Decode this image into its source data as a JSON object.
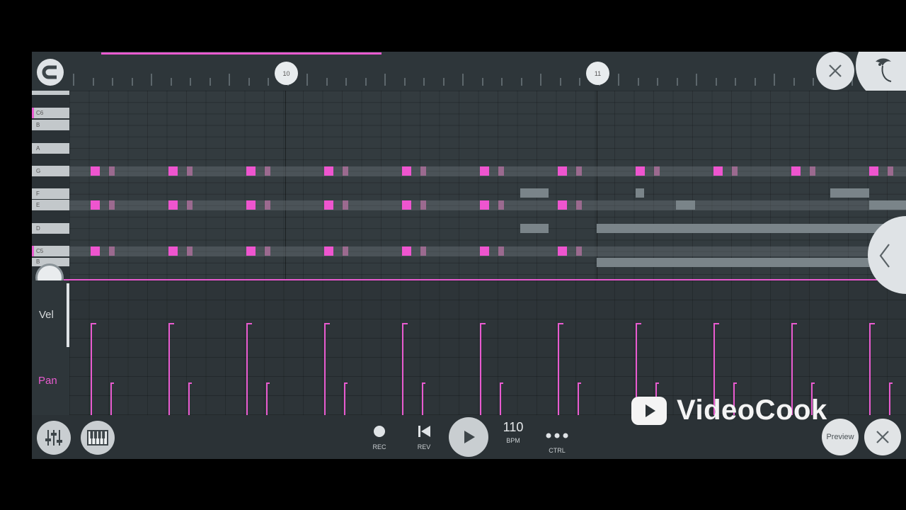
{
  "timeline": {
    "markers": [
      "10",
      "11"
    ]
  },
  "keyboard": {
    "keys": [
      {
        "label": "C6",
        "c": true
      },
      {
        "label": "B",
        "c": false
      },
      {
        "label": "A",
        "c": false
      },
      {
        "label": "G",
        "c": false
      },
      {
        "label": "F",
        "c": false
      },
      {
        "label": "E",
        "c": false
      },
      {
        "label": "D",
        "c": false
      },
      {
        "label": "C5",
        "c": true
      },
      {
        "label": "B",
        "c": false
      }
    ]
  },
  "lanes": {
    "vel_label": "Vel",
    "pan_label": "Pan"
  },
  "transport": {
    "rec_label": "REC",
    "rev_label": "REV",
    "bpm_value": "110",
    "bpm_label": "BPM",
    "ctrl_label": "CTRL",
    "preview_label": "Preview"
  },
  "watermark": {
    "text": "VideoCook"
  },
  "colors": {
    "accent": "#e95bd0",
    "panel": "#2b3236"
  }
}
